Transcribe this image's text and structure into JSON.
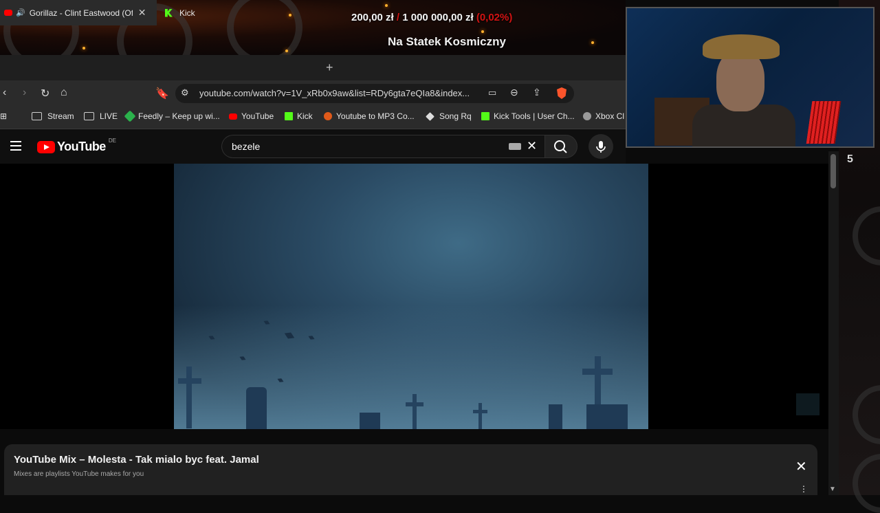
{
  "stream_overlay": {
    "donation_current": "200,00 zł",
    "donation_separator": "/",
    "donation_goal": "1 000 000,00 zł",
    "donation_percent": "(0,02%)",
    "goal_title": "Na Statek Kosmiczny",
    "side_number": "5"
  },
  "browser": {
    "tabs": [
      {
        "label": "Gorillaz - Clint Eastwood (Offi",
        "active": true,
        "audio": true
      },
      {
        "label": "Kick",
        "active": false
      }
    ],
    "new_tab": "+",
    "url": "youtube.com/watch?v=1V_xRb0x9aw&list=RDy6gta7eQIa8&index...",
    "bookmarks": [
      {
        "label": "Stream",
        "type": "folder"
      },
      {
        "label": "LIVE",
        "type": "folder"
      },
      {
        "label": "Feedly – Keep up wi...",
        "icon": "feedly-icon",
        "color": "#2bb24c"
      },
      {
        "label": "YouTube",
        "icon": "youtube-icon",
        "color": "#ff0000"
      },
      {
        "label": "Kick",
        "icon": "kick-icon",
        "color": "#53fc18"
      },
      {
        "label": "Youtube to MP3 Co...",
        "icon": "converter-icon",
        "color": "#e05a1a"
      },
      {
        "label": "Song Rq",
        "icon": "diamond-icon",
        "color": "#dddddd"
      },
      {
        "label": "Kick Tools | User Ch...",
        "icon": "kick-icon",
        "color": "#53fc18"
      },
      {
        "label": "Xbox Cl",
        "icon": "globe-icon",
        "color": "#9a9a9a"
      }
    ]
  },
  "youtube": {
    "logo_text": "YouTube",
    "region": "DE",
    "search_query": "bezele",
    "mix_title": "YouTube Mix – Molesta - Tak mialo byc feat. Jamal",
    "mix_subtitle": "Mixes are playlists YouTube makes for you"
  },
  "colors": {
    "youtube_red": "#ff0000",
    "kick_green": "#53fc18",
    "percent_red": "#d21313"
  }
}
